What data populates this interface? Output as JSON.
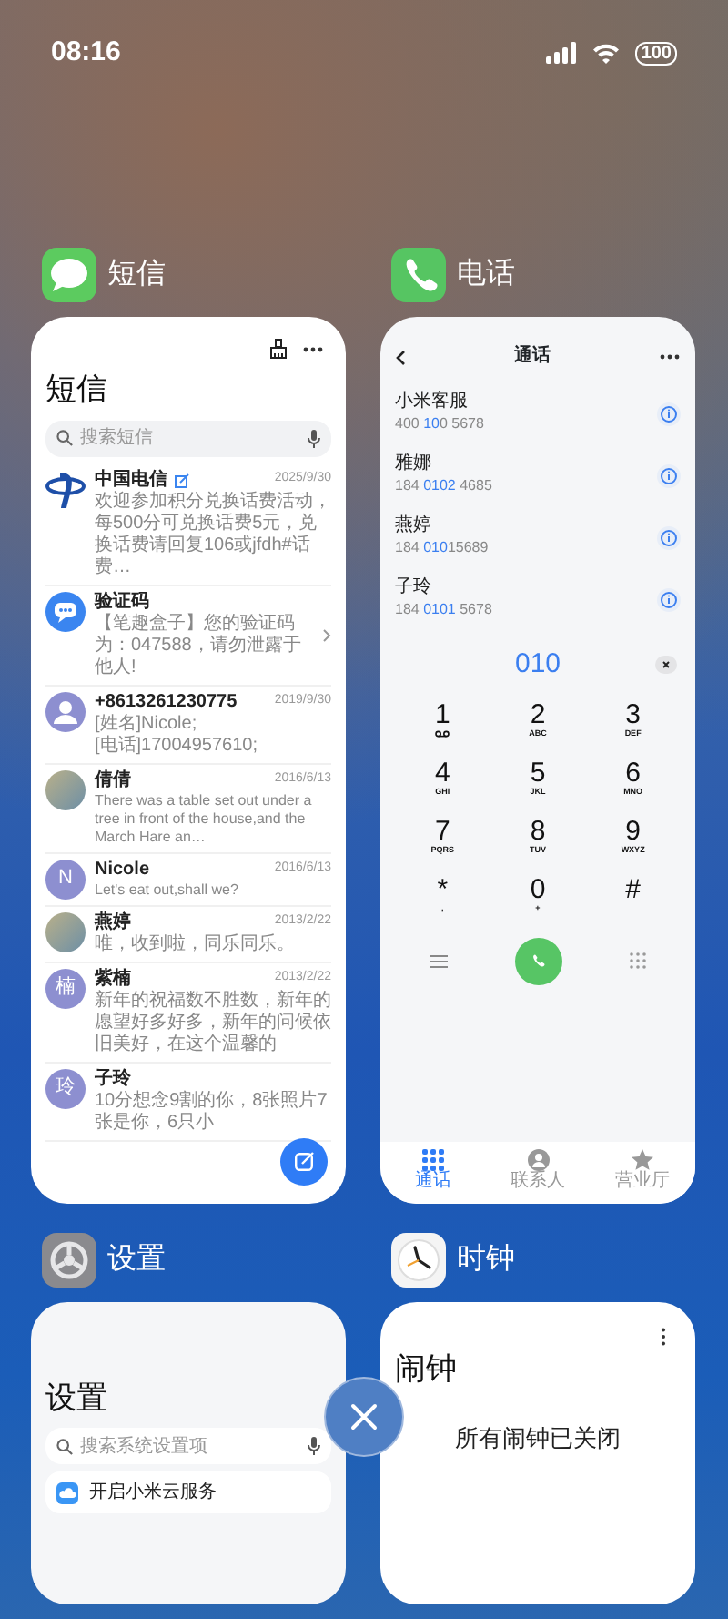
{
  "status_bar": {
    "time": "08:16",
    "battery": "100"
  },
  "apps": [
    {
      "kind": "messages",
      "name": "短信",
      "screen": {
        "title": "短信",
        "search_placeholder": "搜索短信",
        "conversations": [
          {
            "avatar": {
              "kind": "logo"
            },
            "name": "中国电信",
            "badge": true,
            "chevron": false,
            "date": "2025/9/30",
            "preview": "欢迎参加积分兑换话费活动，每500分可兑换话费5元，兑换话费请回复106或jfdh#话费…"
          },
          {
            "avatar": {
              "kind": "chat"
            },
            "name": "验证码",
            "badge": false,
            "chevron": true,
            "preview": "【笔趣盒子】您的验证码为：047588，请勿泄露于他人!"
          },
          {
            "avatar": {
              "kind": "person"
            },
            "name": "+8613261230775",
            "badge": false,
            "chevron": false,
            "date": "2019/9/30",
            "preview": "[姓名]Nicole;\n[电话]17004957610;"
          },
          {
            "avatar": {
              "kind": "photo"
            },
            "name": "倩倩",
            "badge": false,
            "chevron": false,
            "date": "2016/6/13",
            "preview": "There was a table set out under a tree in front of the house,and the March Hare an…"
          },
          {
            "avatar": {
              "kind": "letter",
              "text": "N"
            },
            "name": "Nicole",
            "badge": false,
            "chevron": false,
            "date": "2016/6/13",
            "preview": "Let's eat out,shall we?"
          },
          {
            "avatar": {
              "kind": "photo"
            },
            "name": "燕婷",
            "badge": false,
            "chevron": false,
            "date": "2013/2/22",
            "preview": "唯，收到啦，同乐同乐。"
          },
          {
            "avatar": {
              "kind": "letter",
              "text": "楠"
            },
            "name": "紫楠",
            "badge": false,
            "chevron": false,
            "date": "2013/2/22",
            "preview": "新年的祝福数不胜数，新年的愿望好多好多，新年的问候依旧美好，在这个温馨的"
          },
          {
            "avatar": {
              "kind": "letter",
              "text": "玲"
            },
            "name": "子玲",
            "badge": false,
            "chevron": false,
            "preview": "10分想念9割的你，8张照片7张是你，6只小"
          }
        ]
      }
    },
    {
      "kind": "phone",
      "name": "电话",
      "screen": {
        "title": "通话",
        "contacts": [
          {
            "name": "小米客服",
            "number": [
              {
                "text": "400 ",
                "match": false
              },
              {
                "text": "10",
                "match": true
              },
              {
                "text": "0 5678",
                "match": false
              }
            ]
          },
          {
            "name": "雅娜",
            "number": [
              {
                "text": "184 ",
                "match": false
              },
              {
                "text": "0102",
                "match": true
              },
              {
                "text": " 4685",
                "match": false
              }
            ]
          },
          {
            "name": "燕婷",
            "number": [
              {
                "text": "184 ",
                "match": false
              },
              {
                "text": "010",
                "match": true
              },
              {
                "text": "15689",
                "match": false
              }
            ]
          },
          {
            "name": "子玲",
            "number": [
              {
                "text": "184 ",
                "match": false
              },
              {
                "text": "0101",
                "match": true
              },
              {
                "text": " 5678",
                "match": false
              }
            ]
          }
        ],
        "dialed": "010",
        "keys": [
          {
            "digit": "1",
            "kind": "voicemail"
          },
          {
            "digit": "2",
            "kind": "letters",
            "sub": "ABC"
          },
          {
            "digit": "3",
            "kind": "letters",
            "sub": "DEF"
          },
          {
            "digit": "4",
            "kind": "letters",
            "sub": "GHI"
          },
          {
            "digit": "5",
            "kind": "letters",
            "sub": "JKL"
          },
          {
            "digit": "6",
            "kind": "letters",
            "sub": "MNO"
          },
          {
            "digit": "7",
            "kind": "letters",
            "sub": "PQRS"
          },
          {
            "digit": "8",
            "kind": "letters",
            "sub": "TUV"
          },
          {
            "digit": "9",
            "kind": "letters",
            "sub": "WXYZ"
          },
          {
            "digit": "*",
            "kind": "letters",
            "sub": ","
          },
          {
            "digit": "0",
            "kind": "letters",
            "sub": "+"
          },
          {
            "digit": "#",
            "kind": "letters"
          }
        ],
        "tabs": [
          {
            "kind": "dialpad",
            "label": "通话",
            "selected": true
          },
          {
            "kind": "contacts",
            "label": "联系人",
            "selected": false
          },
          {
            "kind": "star",
            "label": "营业厅",
            "selected": false
          }
        ]
      }
    },
    {
      "kind": "settings",
      "name": "设置",
      "screen": {
        "title": "设置",
        "search_placeholder": "搜索系统设置项",
        "items": [
          {
            "label": "开启小米云服务"
          }
        ]
      }
    },
    {
      "kind": "clock",
      "name": "时钟",
      "screen": {
        "title": "闹钟",
        "empty_text": "所有闹钟已关闭"
      }
    }
  ]
}
